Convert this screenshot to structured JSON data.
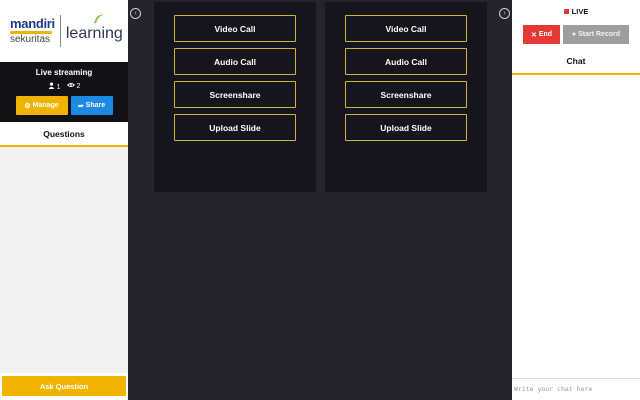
{
  "brand": {
    "company_line1": "mandiri",
    "company_line2": "sekuritas",
    "product": "learning"
  },
  "stream": {
    "title": "Live streaming",
    "participants": "1",
    "viewers": "2",
    "manage_label": "Manage",
    "share_label": "Share"
  },
  "questions": {
    "header": "Questions",
    "ask_label": "Ask Question"
  },
  "tiles": [
    {
      "buttons": [
        "Video Call",
        "Audio Call",
        "Screenshare",
        "Upload Slide"
      ]
    },
    {
      "buttons": [
        "Video Call",
        "Audio Call",
        "Screenshare",
        "Upload Slide"
      ]
    }
  ],
  "live": {
    "label": "LIVE",
    "end_label": "End",
    "record_label": "Start Record"
  },
  "chat": {
    "header": "Chat",
    "placeholder": "Write your chat here"
  },
  "colors": {
    "accent": "#f0b400",
    "share": "#1e88e5",
    "end": "#e53935",
    "background": "#23242e",
    "tile": "#14151d"
  }
}
